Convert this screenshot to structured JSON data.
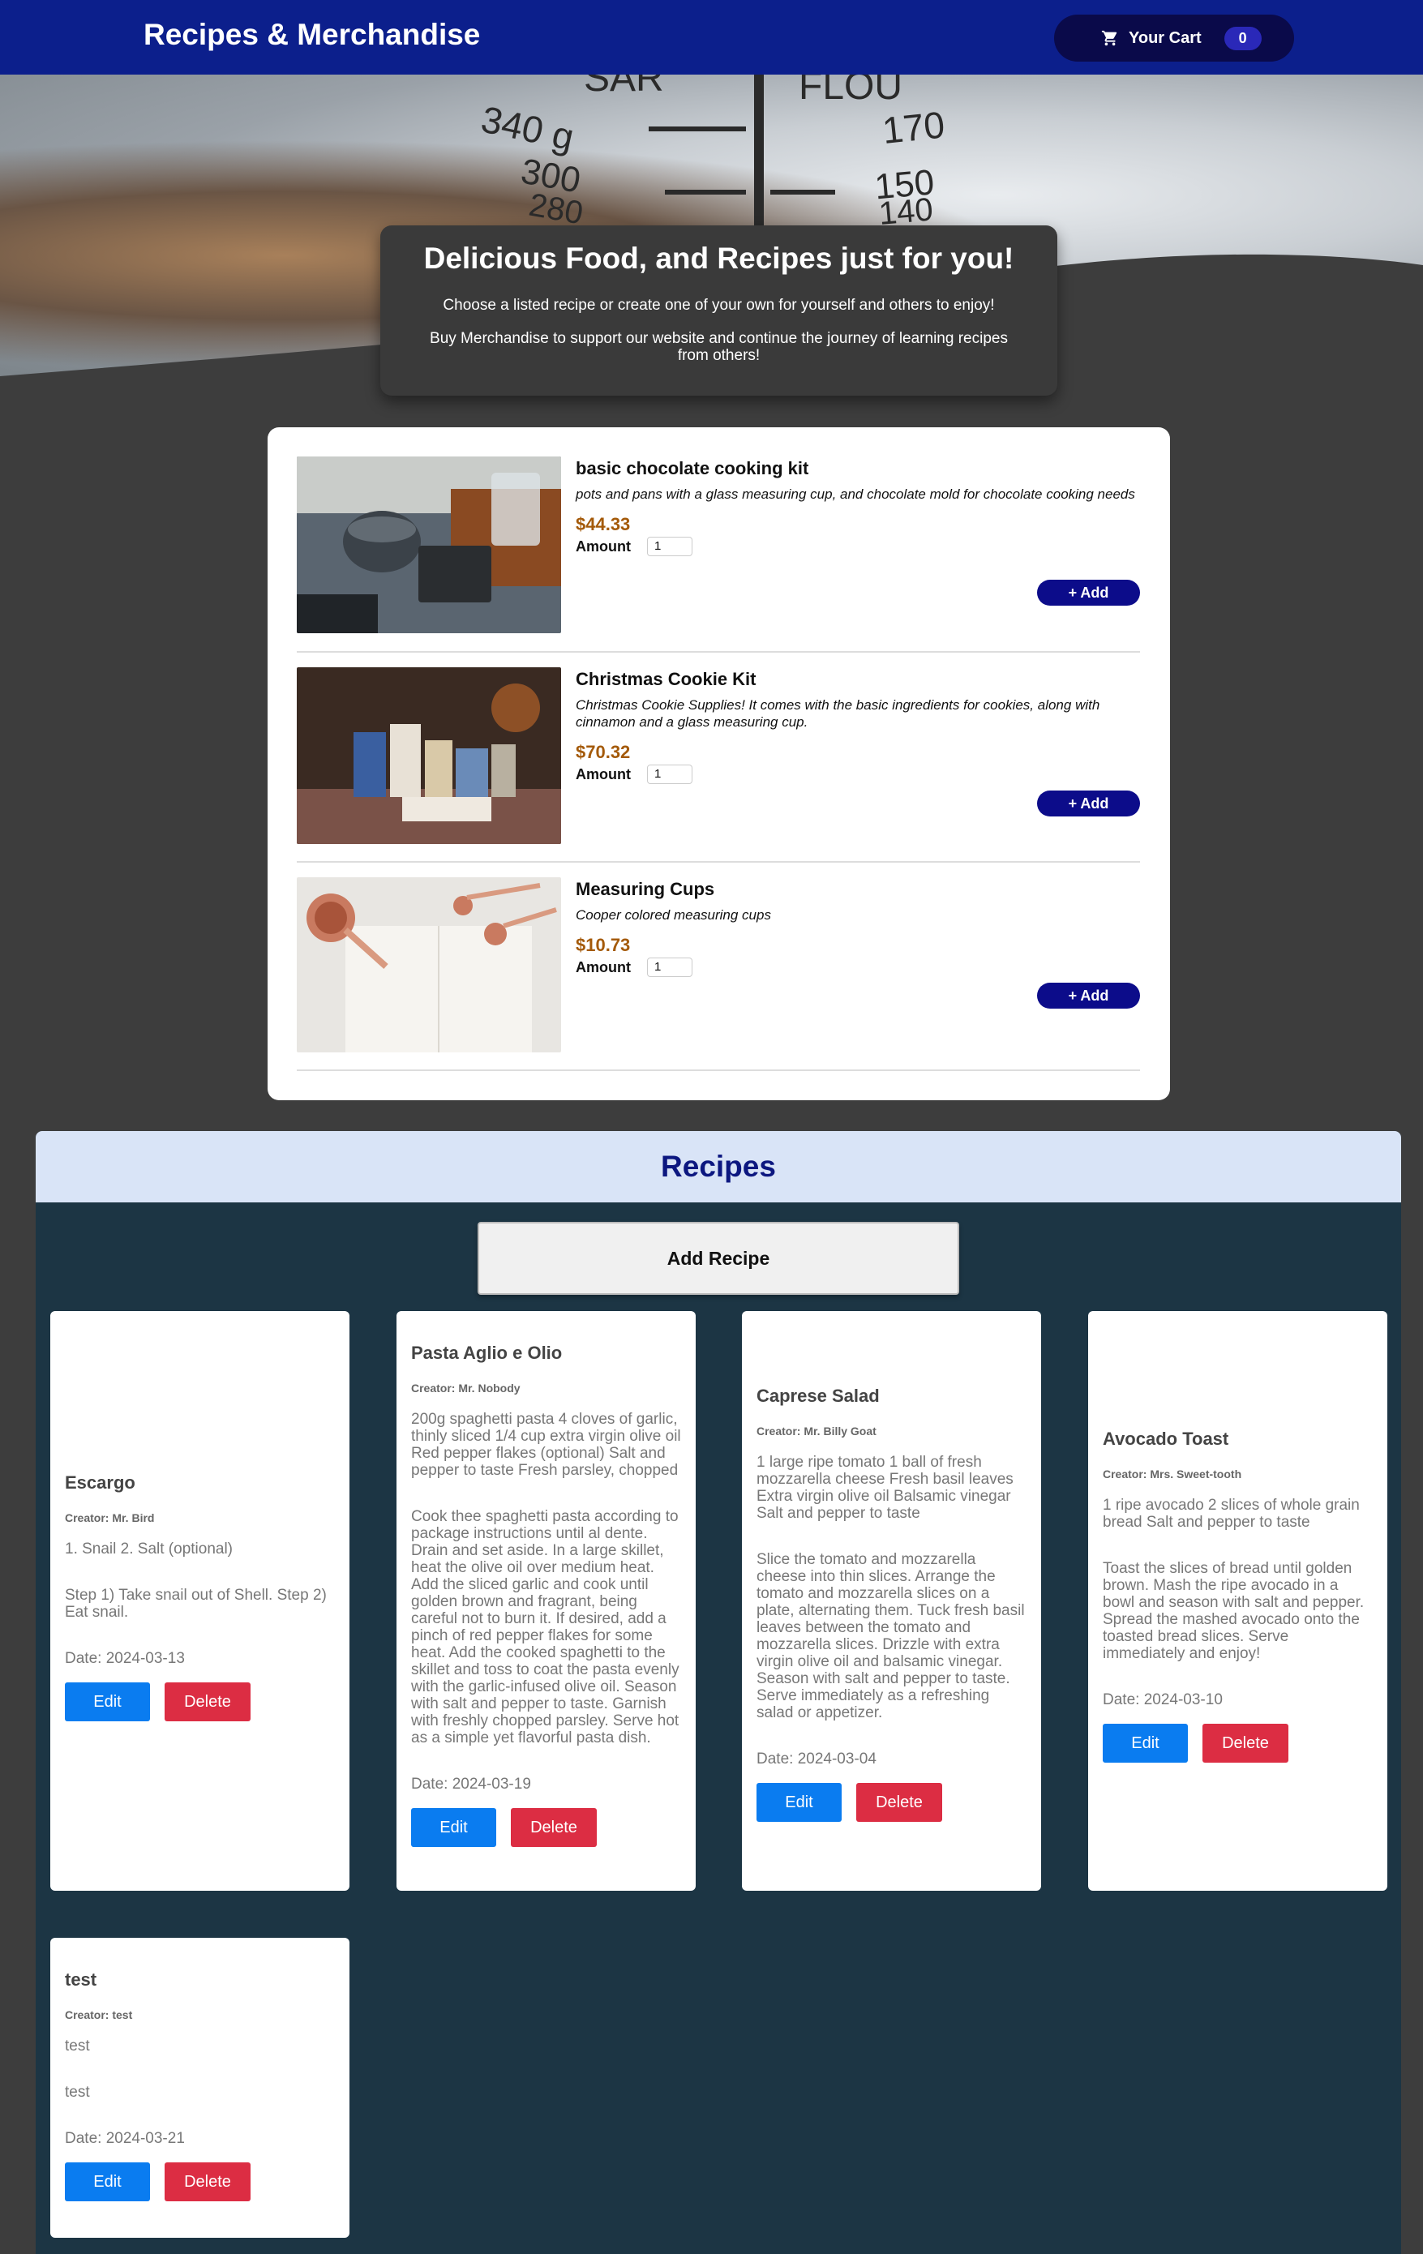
{
  "header": {
    "brand": "Recipes & Merchandise",
    "cart_label": "Your Cart",
    "cart_count": "0"
  },
  "hero": {
    "title": "Delicious Food, and Recipes just for you!",
    "line1": "Choose a listed recipe or create one of your own for yourself and others to enjoy!",
    "line2": "Buy Merchandise to support our website and continue the journey of learning recipes from others!",
    "image_markings": [
      "SAR",
      "FLOU",
      "340 g",
      "170",
      "300",
      "150",
      "280",
      "140"
    ]
  },
  "products": [
    {
      "name": "basic chocolate cooking kit",
      "description": "pots and pans with a glass measuring cup, and chocolate mold for chocolate cooking needs",
      "price": "$44.33",
      "amount_label": "Amount",
      "amount": "1",
      "add_label": "+ Add"
    },
    {
      "name": "Christmas Cookie Kit",
      "description": "Christmas Cookie Supplies! It comes with the basic ingredients for cookies, along with cinnamon and a glass measuring cup.",
      "price": "$70.32",
      "amount_label": "Amount",
      "amount": "1",
      "add_label": "+ Add"
    },
    {
      "name": "Measuring Cups",
      "description": "Cooper colored measuring cups",
      "price": "$10.73",
      "amount_label": "Amount",
      "amount": "1",
      "add_label": "+ Add"
    }
  ],
  "recipes": {
    "heading": "Recipes",
    "add_label": "Add Recipe",
    "edit_label": "Edit",
    "delete_label": "Delete",
    "items": [
      {
        "title": "Escargo",
        "creator": "Creator: Mr. Bird",
        "ingredients": "1. Snail 2. Salt (optional)",
        "steps": "Step 1) Take snail out of Shell. Step 2) Eat snail.",
        "date": "Date: 2024-03-13"
      },
      {
        "title": "Pasta Aglio e Olio",
        "creator": "Creator: Mr. Nobody",
        "ingredients": "200g spaghetti pasta 4 cloves of garlic, thinly sliced 1/4 cup extra virgin olive oil Red pepper flakes (optional) Salt and pepper to taste Fresh parsley, chopped",
        "steps": "Cook thee spaghetti pasta according to package instructions until al dente. Drain and set aside. In a large skillet, heat the olive oil over medium heat. Add the sliced garlic and cook until golden brown and fragrant, being careful not to burn it. If desired, add a pinch of red pepper flakes for some heat. Add the cooked spaghetti to the skillet and toss to coat the pasta evenly with the garlic-infused olive oil. Season with salt and pepper to taste. Garnish with freshly chopped parsley. Serve hot as a simple yet flavorful pasta dish.",
        "date": "Date: 2024-03-19"
      },
      {
        "title": "Caprese Salad",
        "creator": "Creator: Mr. Billy Goat",
        "ingredients": "1 large ripe tomato 1 ball of fresh mozzarella cheese Fresh basil leaves Extra virgin olive oil Balsamic vinegar Salt and pepper to taste",
        "steps": "Slice the tomato and mozzarella cheese into thin slices. Arrange the tomato and mozzarella slices on a plate, alternating them. Tuck fresh basil leaves between the tomato and mozzarella slices. Drizzle with extra virgin olive oil and balsamic vinegar. Season with salt and pepper to taste. Serve immediately as a refreshing salad or appetizer.",
        "date": "Date: 2024-03-04"
      },
      {
        "title": "Avocado Toast",
        "creator": "Creator: Mrs. Sweet-tooth",
        "ingredients": "1 ripe avocado 2 slices of whole grain bread Salt and pepper to taste",
        "steps": "Toast the slices of bread until golden brown. Mash the ripe avocado in a bowl and season with salt and pepper. Spread the mashed avocado onto the toasted bread slices. Serve immediately and enjoy!",
        "date": "Date: 2024-03-10"
      },
      {
        "title": "test",
        "creator": "Creator: test",
        "ingredients": "test",
        "steps": "test",
        "date": "Date: 2024-03-21"
      }
    ]
  },
  "colors": {
    "header_bg": "#0c1f8c",
    "page_bg": "#3d3d3d",
    "recipes_bg": "#1c3544",
    "price": "#a45a0a",
    "add_button": "#0c0c8a",
    "edit_button": "#0a7cf0",
    "delete_button": "#dc2d43"
  }
}
